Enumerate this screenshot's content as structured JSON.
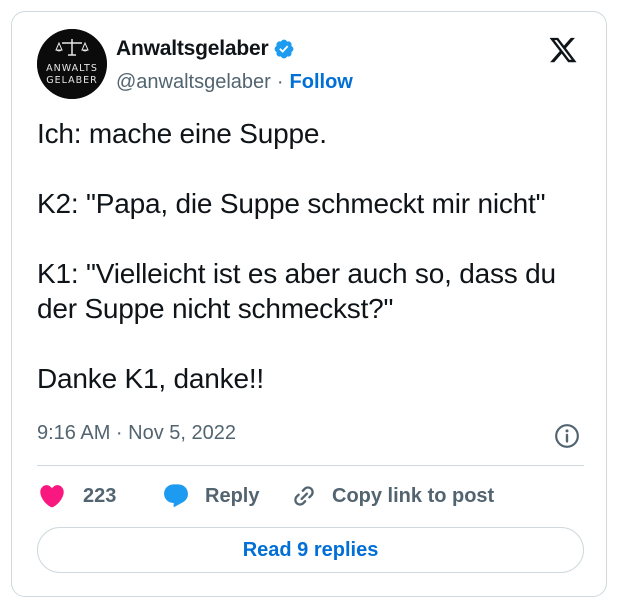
{
  "author": {
    "name": "Anwaltsgelaber",
    "handle": "@anwaltsgelaber",
    "separator": "·",
    "follow_label": "Follow",
    "avatar_text_line1": "ANWALTS",
    "avatar_text_line2": "GELABER",
    "verified_icon": "verified-badge-icon",
    "verified_color": "#1d9bf0"
  },
  "platform_icon": "x-logo-icon",
  "tweet": {
    "lines": [
      "Ich: mache eine Suppe.",
      "K2: \"Papa, die Suppe schmeckt mir nicht\"",
      "K1: \"Vielleicht ist es aber auch so, dass du der Suppe nicht schmeckst?\"",
      "Danke K1, danke!!"
    ],
    "timestamp": "9:16 AM · Nov 5, 2022"
  },
  "actions": {
    "like_count": "223",
    "like_color": "#f91880",
    "reply_label": "Reply",
    "reply_color": "#1d9bf0",
    "copy_label": "Copy link to post"
  },
  "read_replies_label": "Read 9 replies",
  "colors": {
    "accent": "#006fd6",
    "text": "#0f1419",
    "secondary": "#536471",
    "border": "#cfd9de"
  }
}
